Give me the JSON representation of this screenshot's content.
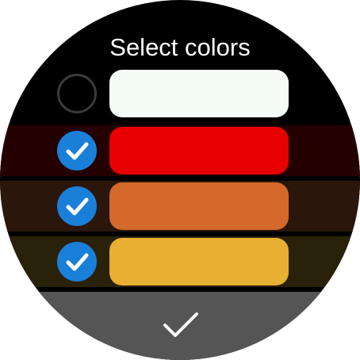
{
  "header": {
    "title": "Select colors"
  },
  "colors": [
    {
      "name": "white",
      "swatch": "#f5fbf6",
      "row_bg": "#000000",
      "selected": false
    },
    {
      "name": "red",
      "swatch": "#e60000",
      "row_bg": "#250000",
      "selected": true
    },
    {
      "name": "orange",
      "swatch": "#d3692a",
      "row_bg": "#2a160a",
      "selected": true
    },
    {
      "name": "yellow",
      "swatch": "#e8b032",
      "row_bg": "#2a210a",
      "selected": true
    }
  ],
  "theme": {
    "check_accent": "#1a7fd9",
    "confirm_bar": "#555555"
  },
  "icons": {
    "selected": "check-circle-icon",
    "unselected": "empty-circle-icon",
    "confirm": "checkmark-icon"
  }
}
